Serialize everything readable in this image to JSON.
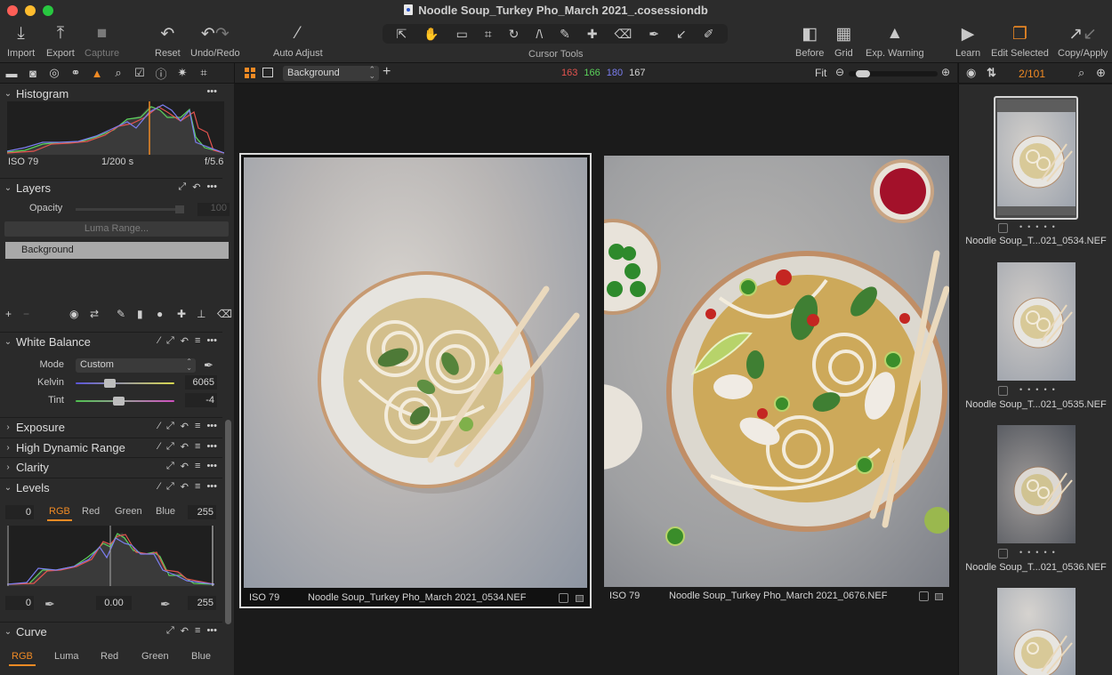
{
  "window": {
    "title": "Noodle Soup_Turkey Pho_March 2021_.cosessiondb"
  },
  "toolbar": {
    "import": "Import",
    "export": "Export",
    "capture": "Capture",
    "reset": "Reset",
    "undo_redo": "Undo/Redo",
    "auto_adjust": "Auto Adjust",
    "cursor_tools": "Cursor Tools",
    "before": "Before",
    "grid": "Grid",
    "exp_warning": "Exp. Warning",
    "learn": "Learn",
    "edit_selected": "Edit Selected",
    "copy_apply": "Copy/Apply"
  },
  "cursor_tools": [
    "select-icon",
    "pan-hand-icon",
    "loupe-icon",
    "crop-icon",
    "rotate-icon",
    "keystone-icon",
    "brush-icon",
    "healing-icon",
    "eraser-icon",
    "color-picker-icon",
    "normalize-icon",
    "annotation-icon"
  ],
  "tool_tabs": [
    "library",
    "capture",
    "color",
    "lens",
    "exposure",
    "details",
    "adjustments",
    "metadata",
    "output",
    "batch",
    "crop"
  ],
  "viewer_bar": {
    "layer_select": "Background",
    "readout": {
      "r": "163",
      "g": "166",
      "b": "180",
      "l": "167"
    },
    "fit": "Fit",
    "zoom_level": 0.1
  },
  "browser_bar": {
    "count": "2/101"
  },
  "histogram": {
    "title": "Histogram",
    "iso": "ISO 79",
    "shutter": "1/200 s",
    "aperture": "f/5.6"
  },
  "layers": {
    "title": "Layers",
    "opacity_label": "Opacity",
    "opacity_value": "100",
    "luma_range": "Luma Range...",
    "items": [
      "Background"
    ]
  },
  "white_balance": {
    "title": "White Balance",
    "mode_label": "Mode",
    "mode_value": "Custom",
    "kelvin_label": "Kelvin",
    "kelvin_value": "6065",
    "kelvin_pos": 0.34,
    "tint_label": "Tint",
    "tint_value": "-4",
    "tint_pos": 0.43
  },
  "sections": {
    "exposure": "Exposure",
    "hdr": "High Dynamic Range",
    "clarity": "Clarity",
    "levels": "Levels",
    "curve": "Curve"
  },
  "levels": {
    "tabs": [
      "RGB",
      "Red",
      "Green",
      "Blue"
    ],
    "active_tab": "RGB",
    "in_low": "0",
    "in_high": "255",
    "out_low": "0",
    "midpoint": "0.00",
    "out_high": "255"
  },
  "curve": {
    "tabs": [
      "RGB",
      "Luma",
      "Red",
      "Green",
      "Blue"
    ],
    "active_tab": "RGB"
  },
  "viewer": {
    "images": [
      {
        "iso": "ISO 79",
        "name": "Noodle Soup_Turkey Pho_March 2021_0534.NEF",
        "selected": true
      },
      {
        "iso": "ISO 79",
        "name": "Noodle Soup_Turkey Pho_March 2021_0676.NEF",
        "selected": false
      }
    ]
  },
  "browser": {
    "thumbnails": [
      {
        "name": "Noodle Soup_T...021_0534.NEF",
        "selected": true
      },
      {
        "name": "Noodle Soup_T...021_0535.NEF",
        "selected": false
      },
      {
        "name": "Noodle Soup_T...021_0536.NEF",
        "selected": false
      },
      {
        "name": "",
        "selected": false
      }
    ]
  },
  "colors": {
    "accent": "#f08a24",
    "readout_r": "#e4534f",
    "readout_g": "#5bd35b",
    "readout_b": "#7b7ef0",
    "readout_l": "#d6d6d6"
  }
}
